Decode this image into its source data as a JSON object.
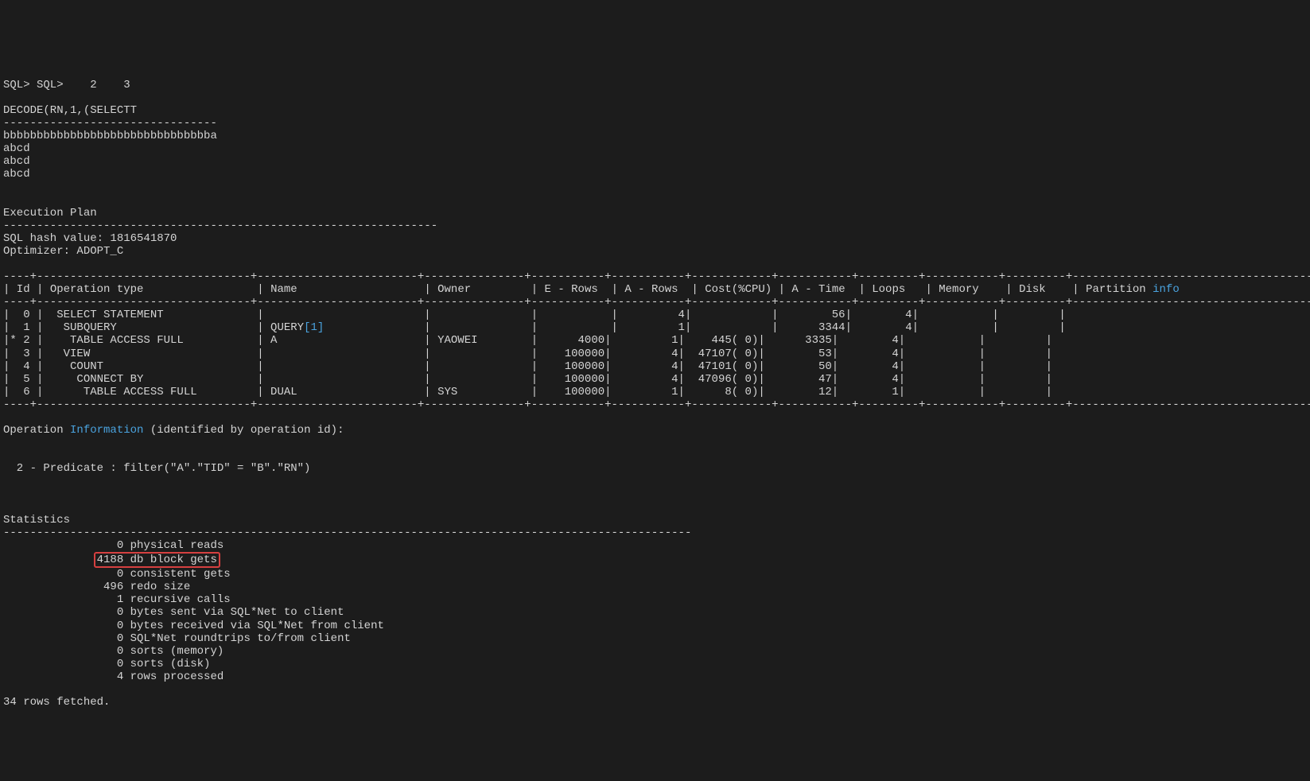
{
  "prompt_line": "SQL> SQL>    2    3",
  "blank1": "",
  "decode_line": "DECODE(RN,1,(SELECTT",
  "decode_sep": "--------------------------------",
  "row1": "bbbbbbbbbbbbbbbbbbbbbbbbbbbbbbba",
  "row2": "abcd",
  "row3": "abcd",
  "row4": "abcd",
  "blank2": "",
  "blank3": "",
  "exec_plan_title": "Execution Plan",
  "exec_plan_sep": "-----------------------------------------------------------------",
  "hash_line": "SQL hash value: 1816541870",
  "optimizer_line": "Optimizer: ADOPT_C",
  "blank4": "",
  "tbl_top_sep": "----+--------------------------------+------------------------+---------------+-----------+-----------+------------+-----------+---------+-----------+---------+---------------------------------------+",
  "hdr_id": "| Id ",
  "hdr_op": "| Operation type                 ",
  "hdr_name": "| Name                   ",
  "hdr_owner": "| Owner         ",
  "hdr_erows": "| E - Rows  ",
  "hdr_arows": "| A - Rows  ",
  "hdr_cost": "| Cost(%CPU) ",
  "hdr_atime": "| A - Time  ",
  "hdr_loops": "| Loops   ",
  "hdr_memory": "| Memory    ",
  "hdr_disk": "| Disk    ",
  "hdr_part_pre": "| Partition ",
  "hdr_part_word": "info",
  "hdr_part_tail": "                        |",
  "hdr_sep": "----+--------------------------------+------------------------+---------------+-----------+-----------+------------+-----------+---------+-----------+---------+---------------------------------------+",
  "plan_rows": [
    {
      "pre": "|  0 |  SELECT STATEMENT              |                        |               |           |         4|            |        56|        4|           |         |                                       |"
    },
    {
      "pre": "|  1 |   SUBQUERY                     | QUERY",
      "blue": "[1]",
      "post": "               |               |           |         1|            |      3344|        4|           |         |                                       |"
    },
    {
      "pre": "|* 2 |    TABLE ACCESS FULL           | A                      | YAOWEI        |      4000|         1|    445( 0)|      3335|        4|           |         |                                       |"
    },
    {
      "pre": "|  3 |   VIEW                         |                        |               |    100000|         4|  47107( 0)|        53|        4|           |         |                                       |"
    },
    {
      "pre": "|  4 |    COUNT                       |                        |               |    100000|         4|  47101( 0)|        50|        4|           |         |                                       |"
    },
    {
      "pre": "|  5 |     CONNECT BY                 |                        |               |    100000|         4|  47096( 0)|        47|        4|           |         |                                       |"
    },
    {
      "pre": "|  6 |      TABLE ACCESS FULL         | DUAL                   | SYS           |    100000|         1|      8( 0)|        12|        1|           |         |                                       |"
    }
  ],
  "tbl_bot_sep": "----+--------------------------------+------------------------+---------------+-----------+-----------+------------+-----------+---------+-----------+---------+---------------------------------------+",
  "blank5": "",
  "opinfo_pre": "Operation ",
  "opinfo_word": "Information",
  "opinfo_post": " (identified by operation id):",
  "blank6": "",
  "blank7": "",
  "predicate": "  2 - Predicate : filter(\"A\".\"TID\" = \"B\".\"RN\")",
  "blank8": "",
  "blank9": "",
  "blank10": "",
  "stats_title": "Statistics",
  "stats_sep": "-------------------------------------------------------------------------------------------------------",
  "stat_phys_reads": "                 0 physical reads",
  "stat_db_block_pre": "              ",
  "stat_db_block": "4188 db block gets",
  "stat_cons_gets": "                 0 consistent gets",
  "stat_redo": "               496 redo size",
  "stat_recursive": "                 1 recursive calls",
  "stat_bytes_sent": "                 0 bytes sent via SQL*Net to client",
  "stat_bytes_recv": "                 0 bytes received via SQL*Net from client",
  "stat_roundtrips": "                 0 SQL*Net roundtrips to/from client",
  "stat_sorts_mem": "                 0 sorts (memory)",
  "stat_sorts_disk": "                 0 sorts (disk)",
  "stat_rows_proc": "                 4 rows processed",
  "blank11": "",
  "fetched": "34 rows fetched."
}
